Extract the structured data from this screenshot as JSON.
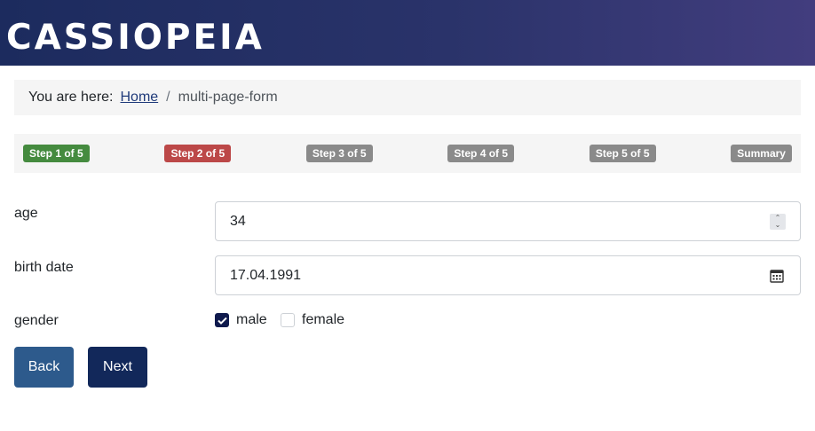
{
  "header": {
    "logo": "CASSIOPEIA"
  },
  "breadcrumb": {
    "prefix": "You are here:",
    "home": "Home",
    "separator": "/",
    "current": "multi-page-form"
  },
  "steps": [
    {
      "label": "Step 1 of 5",
      "state": "done"
    },
    {
      "label": "Step 2 of 5",
      "state": "current"
    },
    {
      "label": "Step 3 of 5",
      "state": "todo"
    },
    {
      "label": "Step 4 of 5",
      "state": "todo"
    },
    {
      "label": "Step 5 of 5",
      "state": "todo"
    },
    {
      "label": "Summary",
      "state": "todo"
    }
  ],
  "form": {
    "age": {
      "label": "age",
      "value": "34"
    },
    "birth_date": {
      "label": "birth date",
      "value": "17.04.1991"
    },
    "gender": {
      "label": "gender",
      "options": [
        {
          "label": "male",
          "checked": true
        },
        {
          "label": "female",
          "checked": false
        }
      ]
    }
  },
  "buttons": {
    "back": "Back",
    "next": "Next"
  },
  "colors": {
    "step_done": "#458b3f",
    "step_current": "#bc4848",
    "step_todo": "#8a8a8a",
    "checkbox_checked": "#0f1a4d",
    "back_button": "#2d5a8c",
    "next_button": "#12285a"
  },
  "icons": {
    "calendar": "calendar-icon",
    "spinner": "spinner-icon",
    "check": "checkmark-icon"
  }
}
